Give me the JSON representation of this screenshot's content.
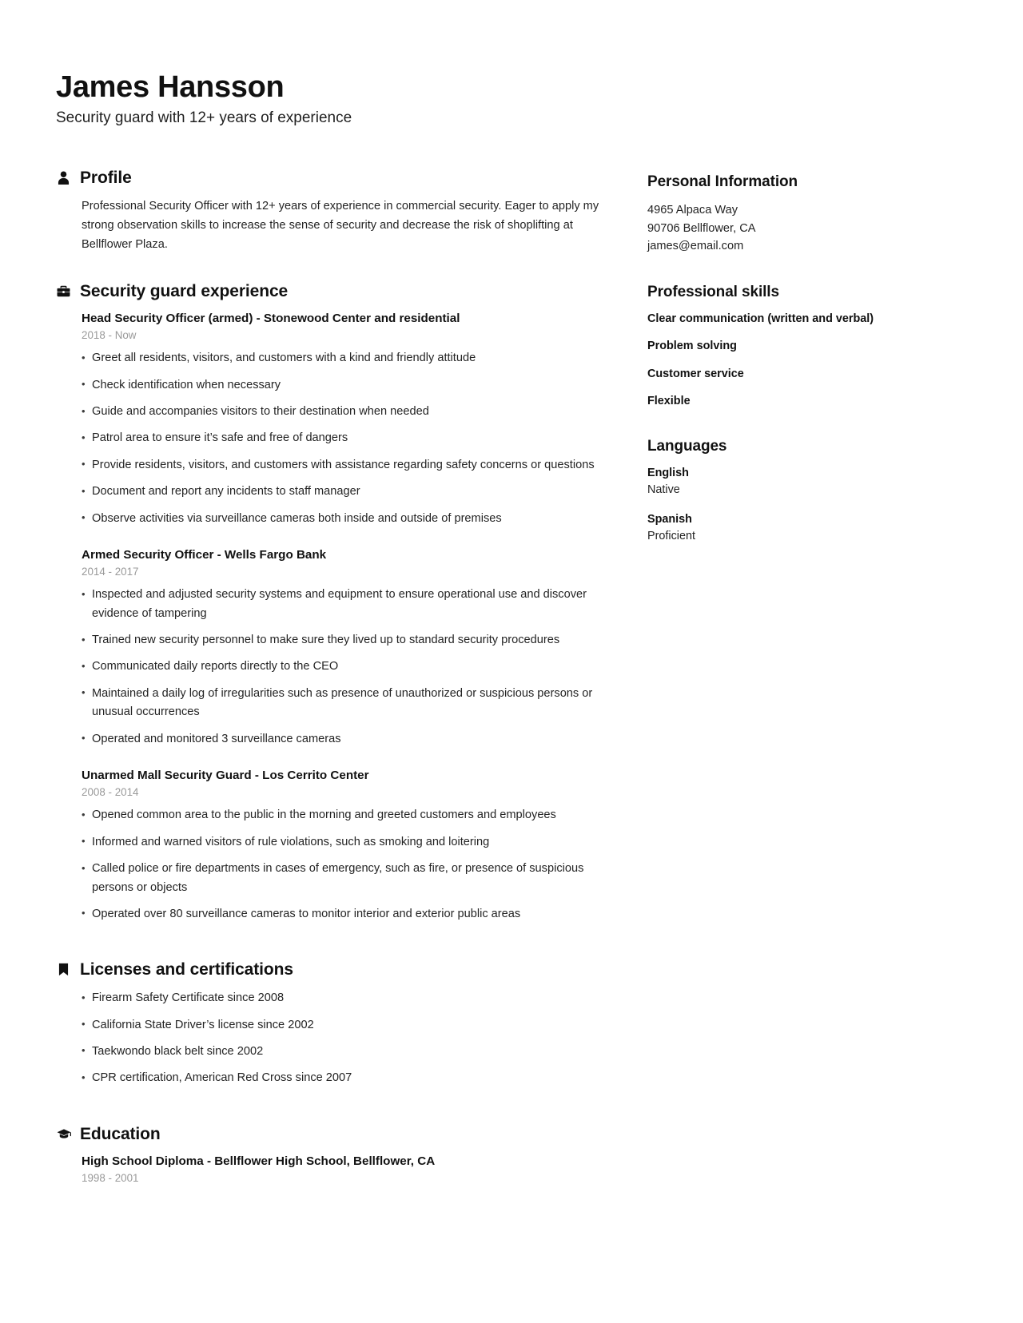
{
  "header": {
    "name": "James Hansson",
    "tagline": "Security guard with 12+ years of experience"
  },
  "main": {
    "profile": {
      "icon": "person-icon",
      "title": "Profile",
      "text": "Professional Security Officer with 12+ years of experience in commercial security. Eager to apply my strong observation skills to increase the sense of security and decrease the risk of shoplifting at Bellflower Plaza."
    },
    "experience": {
      "icon": "briefcase-icon",
      "title": "Security guard experience",
      "entries": [
        {
          "title": "Head Security Officer (armed) - Stonewood Center and residential",
          "date": "2018 - Now",
          "bullets": [
            "Greet all residents, visitors, and customers with a kind and friendly attitude",
            "Check identification when necessary",
            "Guide and accompanies visitors to their destination when needed",
            "Patrol area to ensure it’s safe and free of dangers",
            "Provide residents, visitors, and customers with assistance regarding safety concerns or questions",
            "Document and report any incidents to staff manager",
            "Observe activities via surveillance cameras both inside and outside of premises"
          ]
        },
        {
          "title": "Armed Security Officer - Wells Fargo Bank",
          "date": "2014 - 2017",
          "bullets": [
            "Inspected and adjusted security systems and equipment to ensure operational use and discover evidence of tampering",
            "Trained new security personnel to make sure they lived up to standard security procedures",
            "Communicated daily reports directly to the CEO",
            "Maintained a daily log of irregularities such as presence of unauthorized or suspicious persons or unusual occurrences",
            "Operated and monitored 3 surveillance cameras"
          ]
        },
        {
          "title": "Unarmed Mall Security Guard - Los Cerrito Center",
          "date": "2008 - 2014",
          "bullets": [
            "Opened common area to the public in the morning and greeted customers and employees",
            "Informed and warned visitors of rule violations, such as smoking and loitering",
            "Called police or fire departments in cases of emergency, such as fire, or presence of suspicious persons or objects",
            "Operated over 80 surveillance cameras to monitor interior and exterior public areas"
          ]
        }
      ]
    },
    "licenses": {
      "icon": "bookmark-icon",
      "title": "Licenses and certifications",
      "items": [
        "Firearm Safety Certificate since 2008",
        "California State Driver’s license since 2002",
        "Taekwondo black belt since 2002",
        "CPR certification, American Red Cross since 2007"
      ]
    },
    "education": {
      "icon": "graduation-cap-icon",
      "title": "Education",
      "entries": [
        {
          "title": "High School Diploma - Bellflower High School, Bellflower, CA",
          "date": "1998 - 2001"
        }
      ]
    }
  },
  "sidebar": {
    "personal_information": {
      "title": "Personal Information",
      "lines": [
        "4965 Alpaca Way",
        "90706 Bellflower, CA",
        "james@email.com"
      ]
    },
    "professional_skills": {
      "title": "Professional skills",
      "items": [
        "Clear communication (written and verbal)",
        "Problem solving",
        "Customer service",
        "Flexible"
      ]
    },
    "languages": {
      "title": "Languages",
      "items": [
        {
          "name": "English",
          "level": "Native"
        },
        {
          "name": "Spanish",
          "level": "Proficient"
        }
      ]
    }
  }
}
